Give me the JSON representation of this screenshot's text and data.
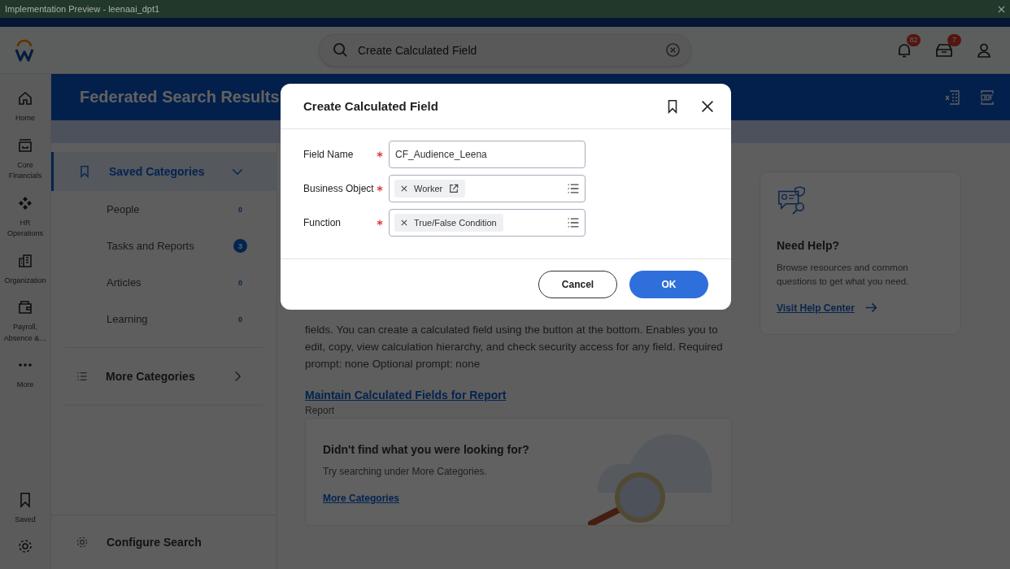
{
  "window": {
    "title": "Implementation Preview - leenaai_dpt1"
  },
  "header": {
    "search": {
      "value": "Create Calculated Field"
    },
    "notifications": "82",
    "inbox": "7"
  },
  "nav": [
    {
      "label": "Home"
    },
    {
      "label": "Core Financials"
    },
    {
      "label": "HR Operations"
    },
    {
      "label": "Organization"
    },
    {
      "label": "Payroll, Absence &…"
    },
    {
      "label": "More"
    }
  ],
  "nav_bottom": {
    "label": "Saved"
  },
  "banner": {
    "title": "Federated Search Results"
  },
  "categories": {
    "title": "Saved Categories",
    "expanded": true,
    "items": [
      {
        "label": "People",
        "count": "0",
        "highlighted": false
      },
      {
        "label": "Tasks and Reports",
        "count": "3",
        "highlighted": true
      },
      {
        "label": "Articles",
        "count": "0",
        "highlighted": false
      },
      {
        "label": "Learning",
        "count": "0",
        "highlighted": false
      }
    ],
    "more": "More Categories",
    "configure": "Configure Search"
  },
  "result": {
    "description": "fields. You can create a calculated field using the button at the bottom. Enables you to edit, copy, view calculation hierarchy, and check security access for any field. Required prompt: none Optional prompt: none",
    "link": "Maintain Calculated Fields for Report",
    "type": "Report"
  },
  "not_found": {
    "title": "Didn't find what you were looking for?",
    "text": "Try searching under More Categories.",
    "link": "More Categories"
  },
  "help": {
    "title": "Need Help?",
    "text": "Browse resources and common questions to get what you need.",
    "link": "Visit Help Center"
  },
  "dialog": {
    "title": "Create Calculated Field",
    "fields": [
      {
        "label": "Field Name",
        "required": true,
        "kind": "text",
        "value": "CF_Audience_Leena"
      },
      {
        "label": "Business Object",
        "required": true,
        "kind": "select",
        "chips": [
          {
            "label": "Worker",
            "link": true
          }
        ]
      },
      {
        "label": "Function",
        "required": true,
        "kind": "select",
        "chips": [
          {
            "label": "True/False Condition",
            "link": false
          }
        ]
      }
    ],
    "cancel": "Cancel",
    "ok": "OK"
  }
}
